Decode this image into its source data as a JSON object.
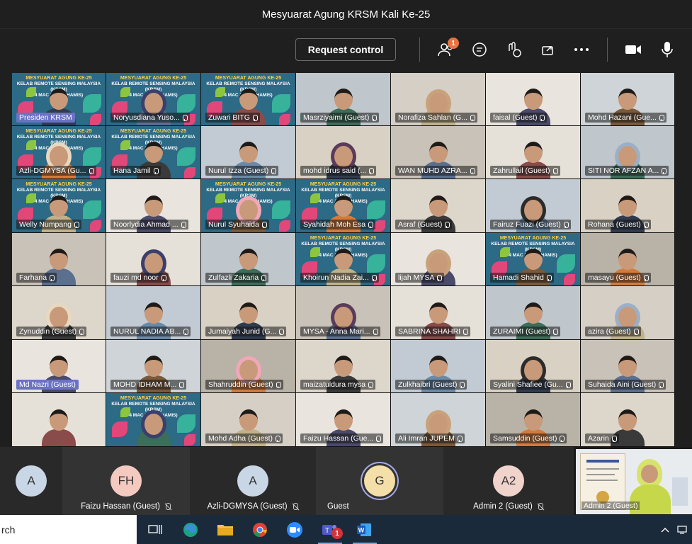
{
  "window": {
    "title": "Mesyuarat Agung KRSM Kali Ke-25"
  },
  "toolbar": {
    "request_control_label": "Request control",
    "participants_badge": "1",
    "icons": [
      "participants-icon",
      "chat-icon",
      "reactions-icon",
      "share-icon",
      "more-icon",
      "camera-icon",
      "microphone-icon"
    ]
  },
  "banner": {
    "line1": "MESYUARAT AGUNG KE-25",
    "line2": "KELAB REMOTE SENSING MALAYSIA (KRSM)",
    "line3": "4 MAC 2021 (KHAMIS)",
    "line_alt": "KELAB REMOTE SENSING MALAYSIA (KRSM)"
  },
  "participants": [
    [
      "Presiden KRSM",
      "Noryusdiana Yuso...",
      "Zuwari BITG",
      "Masrziyaimi (Guest)",
      "Norafiza Sahlan (G...",
      "faisal (Guest)",
      "Mohd Hazani (Gue..."
    ],
    [
      "Azli-DGMYSA (Gu...",
      "Hana Jamil",
      "Nurul Izza (Guest)",
      "mohd idrus said (...",
      "WAN MUHD AZRA...",
      "Zahrullail (Guest)",
      "SITI NOR AFZAN A..."
    ],
    [
      "Welly Numpang",
      "Noorlydia Ahmad ...",
      "Nurul Syuhaida",
      "Syahidah Moh Esa",
      "Asraf (Guest)",
      "Fairuz Fuazi (Guest)",
      "Rohana (Guest)"
    ],
    [
      "Farhana",
      "fauzi md noor",
      "Zulfazli Zakaria",
      "Khoirun Nadia Zai...",
      "lijah MYSA",
      "Hamadi Shahid",
      "masayu (Guest)"
    ],
    [
      "Zynuddin (Guest)",
      "NURUL NADIA AB...",
      "Jumaiyah Junid (G...",
      "MYSA - Anna Mari...",
      "SABRINA SHAHRI",
      "ZURAIMI (Guest)",
      "azira (Guest)"
    ],
    [
      "Md Nazri (Guest)",
      "MOHD IDHAM M...",
      "Shahruddin (Guest)",
      "maizatuldura mysa",
      "Zulkhaibri (Guest)",
      "Syalini Shafiee (Gu...",
      "Suhaida Aini (Guest)"
    ],
    [
      "",
      "",
      "Mohd Adha (Guest)",
      "Faizu Hassan (Gue...",
      "Ali Imran JUPEM",
      "Samsuddin (Guest)",
      "Azarin"
    ]
  ],
  "strip": [
    {
      "initials": "A",
      "name": ""
    },
    {
      "initials": "FH",
      "name": "Faizu Hassan (Guest)"
    },
    {
      "initials": "A",
      "name": "Azli-DGMYSA (Guest)"
    },
    {
      "initials": "G",
      "name": "Guest"
    },
    {
      "initials": "A2",
      "name": "Admin 2 (Guest)"
    },
    {
      "initials": "",
      "name": "Admin 2 (Guest)"
    }
  ],
  "taskbar": {
    "search_text": "rch",
    "teams_badge": "1",
    "apps": [
      "task-view-icon",
      "edge-icon",
      "file-explorer-icon",
      "chrome-icon",
      "zoom-icon",
      "teams-icon",
      "word-icon"
    ]
  },
  "colors": {
    "accent": "#6264a7",
    "badge": "#e8733e",
    "banner_bg": "#2c6a86",
    "taskbar": "#1b2a3a"
  }
}
